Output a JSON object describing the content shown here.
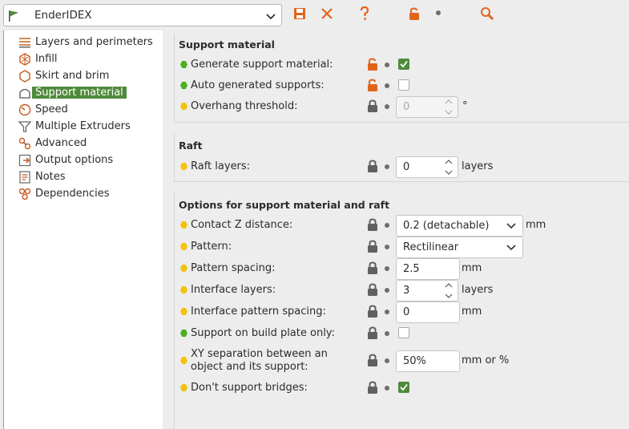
{
  "toolbar": {
    "preset_name": "EnderIDEX",
    "colors": {
      "flag": "#4f8a3c",
      "save": "#4f8a3c",
      "delete": "#e0651b",
      "help": "#e0651b",
      "unlock": "#e0651b",
      "search": "#e0651b"
    }
  },
  "sidebar": {
    "items": [
      {
        "label": "Layers and perimeters",
        "icon": "layers-icon"
      },
      {
        "label": "Infill",
        "icon": "infill-icon"
      },
      {
        "label": "Skirt and brim",
        "icon": "skirt-brim-icon"
      },
      {
        "label": "Support material",
        "icon": "support-icon",
        "selected": true
      },
      {
        "label": "Speed",
        "icon": "speed-icon"
      },
      {
        "label": "Multiple Extruders",
        "icon": "funnel-icon"
      },
      {
        "label": "Advanced",
        "icon": "wrench-icon"
      },
      {
        "label": "Output options",
        "icon": "output-icon"
      },
      {
        "label": "Notes",
        "icon": "notes-icon"
      },
      {
        "label": "Dependencies",
        "icon": "dependencies-icon"
      }
    ]
  },
  "groups": {
    "support": "Support material",
    "raft": "Raft",
    "options": "Options for support material and raft"
  },
  "fields": {
    "generate_support": {
      "label": "Generate support material:",
      "checked": true
    },
    "auto_supports": {
      "label": "Auto generated supports:",
      "checked": false
    },
    "overhang": {
      "label": "Overhang threshold:",
      "value": "0",
      "unit": "°"
    },
    "raft_layers": {
      "label": "Raft layers:",
      "value": "0",
      "unit": "layers"
    },
    "contact_z": {
      "label": "Contact Z distance:",
      "value": "0.2 (detachable)",
      "unit": "mm"
    },
    "pattern": {
      "label": "Pattern:",
      "value": "Rectilinear"
    },
    "pattern_spacing": {
      "label": "Pattern spacing:",
      "value": "2.5",
      "unit": "mm"
    },
    "interface_layers": {
      "label": "Interface layers:",
      "value": "3",
      "unit": "layers"
    },
    "interface_spacing": {
      "label": "Interface pattern spacing:",
      "value": "0",
      "unit": "mm"
    },
    "build_plate_only": {
      "label": "Support on build plate only:",
      "checked": false
    },
    "xy_separation": {
      "label": "XY separation between an object and its support:",
      "value": "50%",
      "unit": "mm or %"
    },
    "dont_support_bridges": {
      "label": "Don't support bridges:",
      "checked": true
    }
  }
}
